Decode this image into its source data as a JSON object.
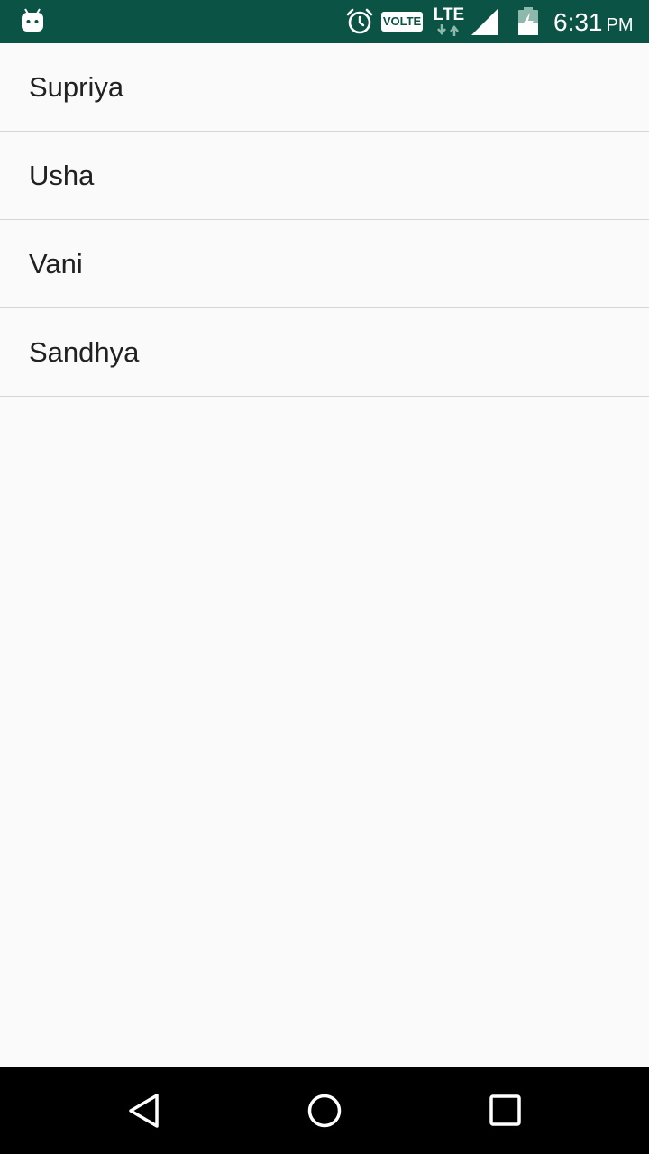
{
  "status_bar": {
    "time": "6:31",
    "ampm": "PM",
    "volte_label": "VOLTE",
    "network_label": "LTE",
    "icons": [
      "android-notification-icon",
      "alarm-icon",
      "volte-icon",
      "lte-icon",
      "signal-icon",
      "battery-charging-icon"
    ]
  },
  "list": {
    "items": [
      {
        "label": "Supriya"
      },
      {
        "label": "Usha"
      },
      {
        "label": "Vani"
      },
      {
        "label": "Sandhya"
      }
    ]
  },
  "nav_bar": {
    "icons": [
      "back-icon",
      "home-icon",
      "recents-icon"
    ]
  },
  "colors": {
    "status_bar": "#0b5345",
    "background": "#fafafa",
    "divider": "#d6d6d6",
    "text": "#212121",
    "nav_bar": "#000000"
  }
}
